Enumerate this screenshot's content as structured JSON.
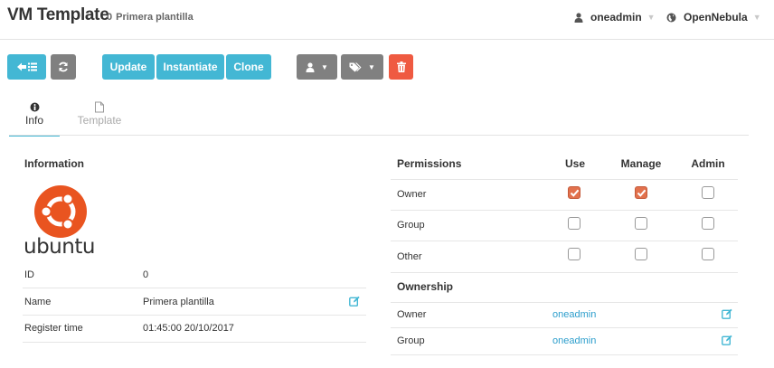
{
  "header": {
    "title": "VM Template",
    "template_id": "0",
    "template_name": "Primera plantilla",
    "user_menu": {
      "label": "oneadmin",
      "icon": "user-icon"
    },
    "zone_menu": {
      "label": "OpenNebula",
      "icon": "globe-icon"
    }
  },
  "toolbar": {
    "back_icon": "arrow-left-list-icon",
    "refresh_icon": "refresh-icon",
    "update_label": "Update",
    "instantiate_label": "Instantiate",
    "clone_label": "Clone",
    "user_menu_icon": "user-icon",
    "labels_menu_icon": "tags-icon",
    "delete_icon": "trash-icon"
  },
  "tabs": [
    {
      "label": "Info",
      "icon": "info-circle-icon",
      "active": true
    },
    {
      "label": "Template",
      "icon": "file-icon",
      "active": false
    }
  ],
  "information": {
    "title": "Information",
    "logo_text": "ubuntu",
    "rows": [
      {
        "label": "ID",
        "value": "0"
      },
      {
        "label": "Name",
        "value": "Primera plantilla"
      },
      {
        "label": "Register time",
        "value": "01:45:00 20/10/2017"
      }
    ]
  },
  "permissions": {
    "title": "Permissions",
    "columns": [
      "Use",
      "Manage",
      "Admin"
    ],
    "rows": [
      {
        "label": "Owner",
        "use": true,
        "manage": true,
        "admin": false
      },
      {
        "label": "Group",
        "use": false,
        "manage": false,
        "admin": false
      },
      {
        "label": "Other",
        "use": false,
        "manage": false,
        "admin": false
      }
    ]
  },
  "ownership": {
    "title": "Ownership",
    "rows": [
      {
        "label": "Owner",
        "value": "oneadmin"
      },
      {
        "label": "Group",
        "value": "oneadmin"
      }
    ]
  },
  "colors": {
    "primary": "#43b7d4",
    "secondary": "#808080",
    "danger": "#ef5a41",
    "checkbox_checked": "#e2714d",
    "link": "#2d9ecc",
    "ubuntu": "#e95420"
  }
}
